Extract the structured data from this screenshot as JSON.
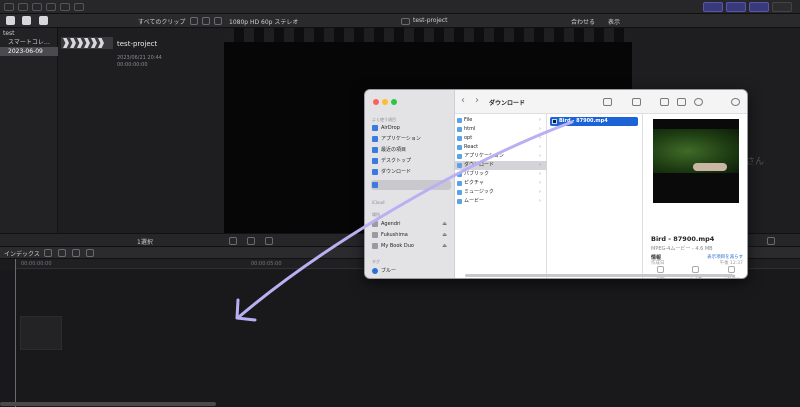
{
  "top_bar": {
    "icons": [
      "library-icon",
      "photos-icon",
      "titles-icon"
    ]
  },
  "browser_bar": {
    "filter_label": "すべてのクリップ",
    "format_label": "1080p HD 60p ステレオ",
    "project_label": "test-project",
    "fit_label": "合わせる",
    "view_label": "表示"
  },
  "sidebar": {
    "items": [
      {
        "label": "test"
      },
      {
        "label": "スマートコレ…"
      },
      {
        "label": "2023-06-09"
      }
    ]
  },
  "browser": {
    "clip": {
      "title": "test-project",
      "date": "2023/06/21 20:44",
      "duration": "00:00:00:00"
    }
  },
  "right_panel": {
    "ghost_text": "さん"
  },
  "status_bar": {
    "selection": "1選択"
  },
  "timeline": {
    "index_label": "インデックス",
    "ruler": [
      "00:00:00:00",
      "00:00:05:00"
    ]
  },
  "finder": {
    "title": "ダウンロード",
    "sidebar": {
      "favorites_label": "よく使う項目",
      "favorites": [
        {
          "label": "AirDrop"
        },
        {
          "label": "アプリケーション"
        },
        {
          "label": "最近の項目"
        },
        {
          "label": "デスクトップ"
        },
        {
          "label": "ダウンロード"
        }
      ],
      "icloud_label": "iCloud",
      "locations_label": "場所",
      "locations": [
        {
          "label": "Agendri"
        },
        {
          "label": "Fukushima"
        },
        {
          "label": "My Book Duo"
        }
      ],
      "tags_label": "タグ",
      "tags": [
        {
          "label": "ブルー"
        }
      ]
    },
    "column1": [
      {
        "label": "File"
      },
      {
        "label": "html"
      },
      {
        "label": "opt"
      },
      {
        "label": "React"
      },
      {
        "label": "アプリケーション"
      },
      {
        "label": "ダウンロード"
      },
      {
        "label": "パブリック"
      },
      {
        "label": "ピクチャ"
      },
      {
        "label": "ミュージック"
      },
      {
        "label": "ムービー"
      }
    ],
    "selected_file": "Bird - 87900.mp4",
    "preview": {
      "name": "Bird - 87900.mp4",
      "kind": "MPEG-4ムービー - 4.6 MB",
      "info_label": "情報",
      "more_label": "表示項目を減らす",
      "meta_label": "作成日",
      "meta_value": "午後 12:37",
      "actions": [
        "回転",
        "トリム",
        "その他..."
      ]
    }
  }
}
